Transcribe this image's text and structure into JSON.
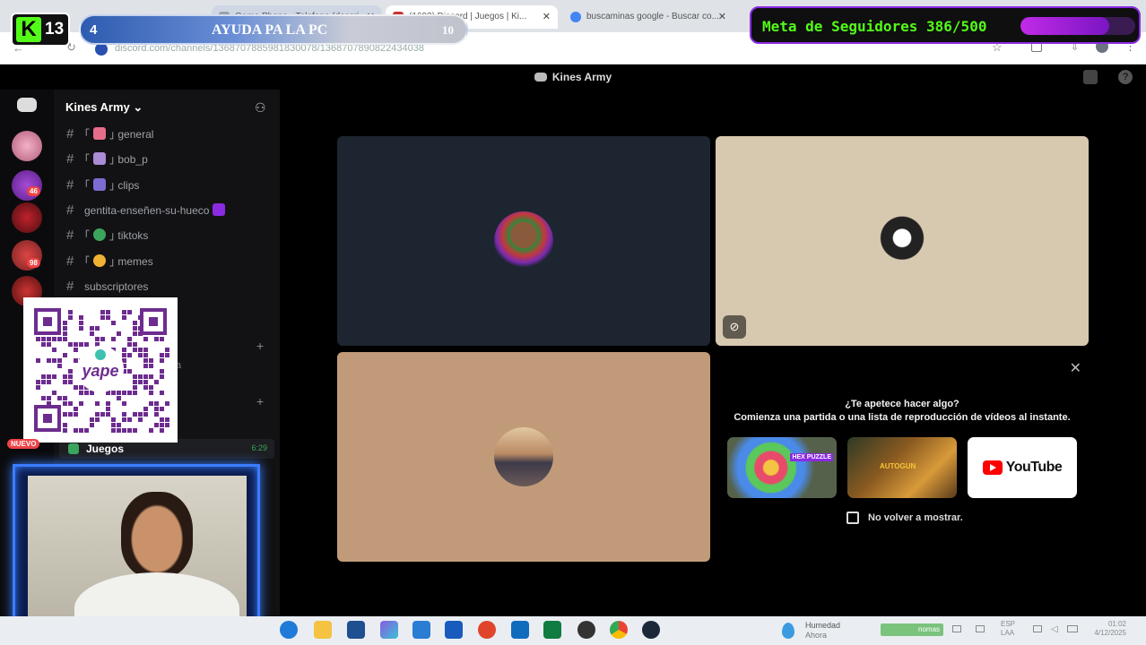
{
  "browser": {
    "tabs": [
      {
        "label": "Game Phone - Telefono (descri...",
        "color": "#9aa0a6"
      },
      {
        "label": "(1693) Discord | Juegos | Ki...",
        "color": "#c33"
      },
      {
        "label": "buscaminas google - Buscar co...",
        "color": "#4285f4"
      }
    ],
    "url": "discord.com/channels/1368707885981830078/1368707890822434038"
  },
  "overlay": {
    "kick_label": "K",
    "kick_count": "13",
    "goal_number": "4",
    "goal_text": "AYUDA PA LA PC",
    "goal_total": "10",
    "followers_label": "Meta de Seguidores 386/500",
    "followers_progress": 0.772,
    "new_badge": "NUEVO"
  },
  "discord": {
    "window_title": "Kines Army",
    "server_name": "Kines Army",
    "server_chevron": "⌄",
    "add_member_icon": "add-member-icon",
    "channels": [
      {
        "prefix": "｢",
        "emoji_color": "#e86d8a",
        "name": "general",
        "suffix": "｣"
      },
      {
        "prefix": "｢",
        "emoji_color": "#a98bd6",
        "name": "bob_p",
        "suffix": "｣"
      },
      {
        "prefix": "｢",
        "emoji_color": "#7d6bd2",
        "name": "clips",
        "suffix": "｣"
      },
      {
        "prefix": "",
        "emoji_color": "#8a2be2",
        "name": "gentita-enseñen-su-hueco",
        "suffix": ""
      },
      {
        "prefix": "｢",
        "emoji_color": "#3ba55d",
        "name": "tiktoks",
        "suffix": "｣"
      },
      {
        "prefix": "｢",
        "emoji_color": "#f0b232",
        "name": "memes",
        "suffix": "｣"
      },
      {
        "prefix": "",
        "emoji_color": "",
        "name": "subscriptores",
        "suffix": ""
      }
    ],
    "partial_channel": "a",
    "voice_channel": {
      "name": "Juegos",
      "time": "6:29"
    },
    "guild_badges": [
      "46",
      "98"
    ],
    "activity": {
      "question": "¿Te apetece hacer algo?",
      "description": "Comienza una partida o una lista de reproducción de vídeos al instante.",
      "cards": [
        "Hex Puzzle",
        "Autogun Heroes",
        "YouTube"
      ],
      "youtube_label": "YouTube",
      "hex_label": "HEX PUZZLE",
      "autogun_label": "AUTOGUN",
      "checkbox_label": "No volver a mostrar."
    }
  },
  "taskbar": {
    "weather_title": "Humedad",
    "weather_sub": "Ahora",
    "tray_nomas": "nomas",
    "lang": "ESP",
    "lang_sub": "LAA",
    "clock_time": "01:02",
    "clock_date": "4/12/2025"
  },
  "colors": {
    "kick_green": "#53fc18",
    "discord_bg": "#121214",
    "tile_dark": "#1d2530",
    "tile_beige": "#d7c8b0",
    "tile_tan": "#c19b79",
    "cam_border": "#3a7dff"
  }
}
